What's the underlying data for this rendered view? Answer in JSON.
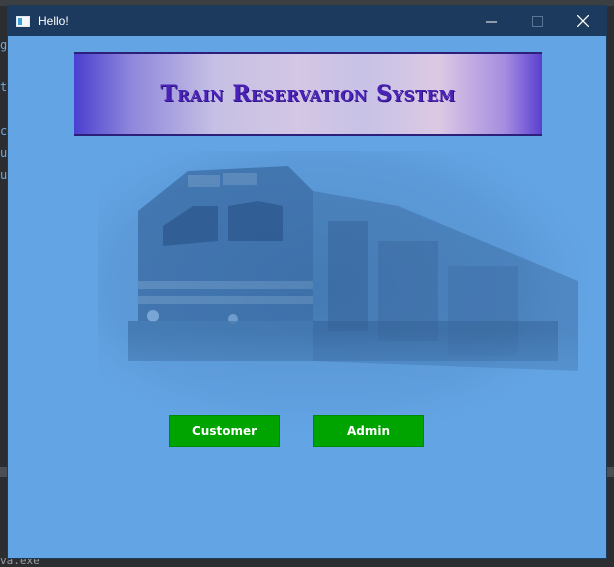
{
  "window": {
    "title": "Hello!",
    "controls": {
      "minimize": "—",
      "maximize": "☐",
      "close": "✕"
    }
  },
  "banner": {
    "title": "Train Reservation System"
  },
  "buttons": {
    "customer": "Customer",
    "admin": "Admin"
  },
  "background": {
    "code_chars": [
      "g",
      "t",
      "c",
      "u",
      "u"
    ],
    "bottom_text": "va.exe\""
  },
  "colors": {
    "window_bg": "#63a4e4",
    "titlebar": "#1c3a5e",
    "banner_text": "#4b22b8",
    "button_bg": "#00a400"
  }
}
